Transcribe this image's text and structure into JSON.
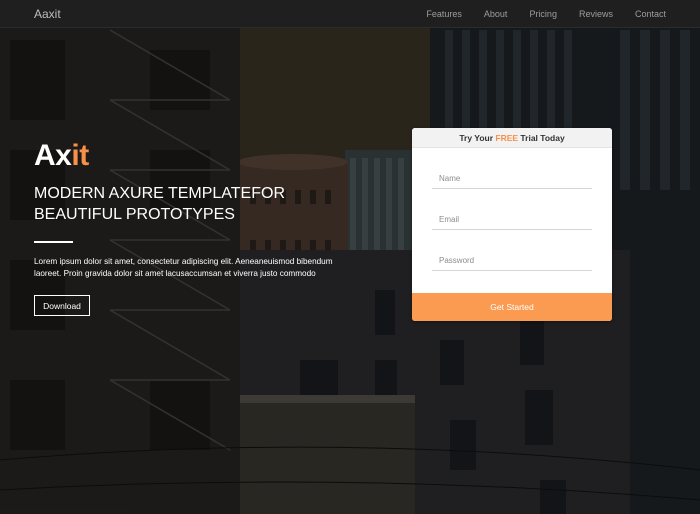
{
  "navbar": {
    "brand": "Aaxit",
    "items": [
      {
        "label": "Features"
      },
      {
        "label": "About"
      },
      {
        "label": "Pricing"
      },
      {
        "label": "Reviews"
      },
      {
        "label": "Contact"
      }
    ]
  },
  "hero": {
    "logo_main": "Ax",
    "logo_accent": "it",
    "headline_line1": "MODERN AXURE TEMPLATEFOR",
    "headline_line2": "BEAUTIFUL PROTOTYPES",
    "lead": "Lorem ipsum dolor sit amet, consectetur adipiscing elit. Aeneaneuismod bibendum laoreet. Proin gravida dolor sit amet lacusaccumsan et viverra justo commodo",
    "download_label": "Download"
  },
  "trial_card": {
    "title_before": "Try Your ",
    "title_highlight": "FREE",
    "title_after": " Trial Today",
    "name_placeholder": "Name",
    "email_placeholder": "Email",
    "password_placeholder": "Password",
    "submit_label": "Get Started"
  },
  "colors": {
    "accent": "#f7914a",
    "button": "#fb9b52",
    "navbar": "#1f1f1f"
  }
}
